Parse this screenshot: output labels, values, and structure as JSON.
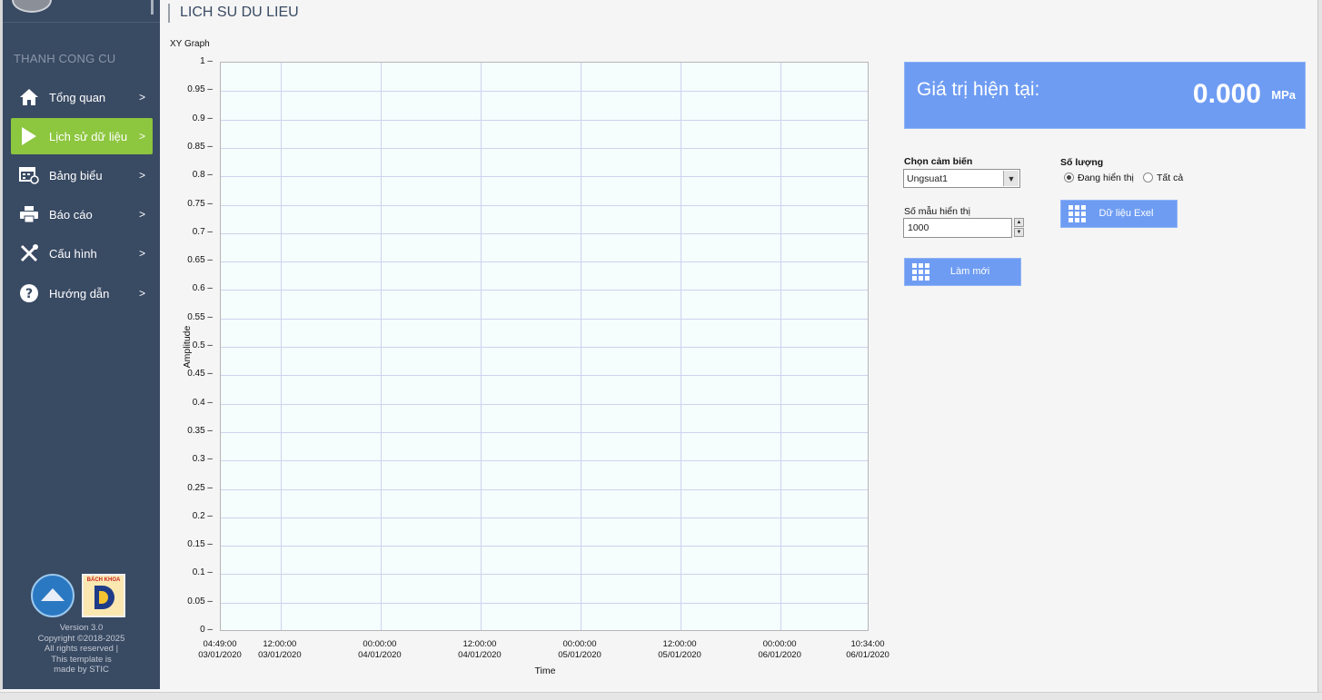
{
  "page": {
    "title": "LICH SU DU LIEU"
  },
  "sidebar": {
    "section_title": "THANH CONG CU",
    "items": [
      {
        "label": "Tổng quan",
        "arrow": ">",
        "icon": "home-icon",
        "active": false
      },
      {
        "label": "Lịch sử dữ liệu",
        "arrow": ">",
        "icon": "play-icon",
        "active": true
      },
      {
        "label": "Bảng biểu",
        "arrow": ">",
        "icon": "calendar-table-icon",
        "active": false
      },
      {
        "label": "Báo cáo",
        "arrow": ">",
        "icon": "printer-icon",
        "active": false
      },
      {
        "label": "Cấu hình",
        "arrow": ">",
        "icon": "tools-icon",
        "active": false
      },
      {
        "label": "Hướng dẫn",
        "arrow": ">",
        "icon": "help-icon",
        "active": false
      }
    ],
    "logo_text_top": "BÁCH KHOA",
    "footer": [
      "Version 3.0",
      "Copyright ©2018-2025",
      "All rights reserved |",
      "This template is",
      "made by STIC"
    ]
  },
  "graph": {
    "title": "XY Graph"
  },
  "chart_data": {
    "type": "line",
    "title": "XY Graph",
    "xlabel": "Time",
    "ylabel": "Amplitude",
    "ylim": [
      0,
      1
    ],
    "yticks": [
      "0",
      "0.05",
      "0.1",
      "0.15",
      "0.2",
      "0.25",
      "0.3",
      "0.35",
      "0.4",
      "0.45",
      "0.5",
      "0.55",
      "0.6",
      "0.65",
      "0.7",
      "0.75",
      "0.8",
      "0.85",
      "0.9",
      "0.95",
      "1"
    ],
    "xticks": [
      {
        "time": "04:49:00",
        "date": "03/01/2020"
      },
      {
        "time": "12:00:00",
        "date": "03/01/2020"
      },
      {
        "time": "00:00:00",
        "date": "04/01/2020"
      },
      {
        "time": "12:00:00",
        "date": "04/01/2020"
      },
      {
        "time": "00:00:00",
        "date": "05/01/2020"
      },
      {
        "time": "12:00:00",
        "date": "05/01/2020"
      },
      {
        "time": "00:00:00",
        "date": "06/01/2020"
      },
      {
        "time": "10:34:00",
        "date": "06/01/2020"
      }
    ],
    "xlim": [
      "03/01/2020 04:49:00",
      "06/01/2020 10:34:00"
    ],
    "series": [],
    "grid": true
  },
  "current_value": {
    "label": "Giá trị hiện tại:",
    "value": "0.000",
    "unit": "MPa"
  },
  "controls": {
    "sensor_label": "Chọn cảm biến",
    "sensor_value": "Ungsuat1",
    "samples_label": "Số mẫu hiển thị",
    "samples_value": "1000",
    "refresh_label": "Làm mới",
    "quantity_label": "Số lượng",
    "radio_displaying": "Đang hiển thị",
    "radio_all": "Tất cả",
    "excel_label": "Dữ liệu Exel"
  },
  "colors": {
    "sidebar": "#394a63",
    "accent": "#8dc63f",
    "button": "#6e9cf3",
    "plot_bg": "#f5fdfd",
    "grid": "#cfd3ee"
  }
}
